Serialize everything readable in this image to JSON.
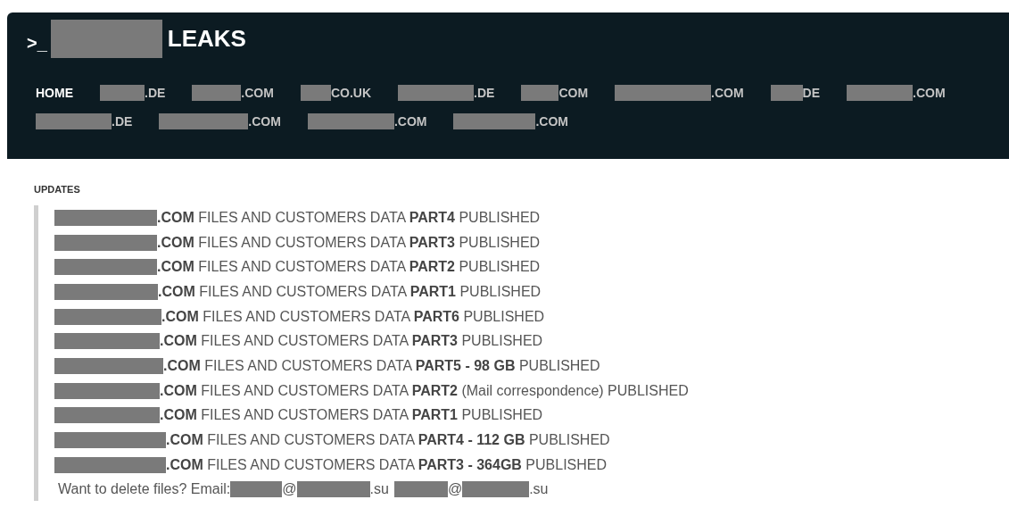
{
  "header": {
    "prompt": ">_",
    "title": "LEAKS"
  },
  "nav": [
    {
      "label": "HOME",
      "selected": true,
      "redacted": false
    },
    {
      "label": ".DE",
      "selected": false,
      "redacted": true
    },
    {
      "label": ".COM",
      "selected": false,
      "redacted": true
    },
    {
      "label": "CO.UK",
      "selected": false,
      "redacted": true
    },
    {
      "label": ".DE",
      "selected": false,
      "redacted": true
    },
    {
      "label": "COM",
      "selected": false,
      "redacted": true
    },
    {
      "label": ".COM",
      "selected": false,
      "redacted": true
    },
    {
      "label": "DE",
      "selected": false,
      "redacted": true
    },
    {
      "label": ".COM",
      "selected": false,
      "redacted": true
    },
    {
      "label": ".DE",
      "selected": false,
      "redacted": true
    },
    {
      "label": ".COM",
      "selected": false,
      "redacted": true
    },
    {
      "label": ".COM",
      "selected": false,
      "redacted": true
    },
    {
      "label": ".COM",
      "selected": false,
      "redacted": true
    }
  ],
  "updates": {
    "heading": "UPDATES",
    "items": [
      {
        "text": "**.COM** FILES AND CUSTOMERS DATA **PART4** PUBLISHED"
      },
      {
        "text": "**.COM** FILES AND CUSTOMERS DATA **PART3** PUBLISHED"
      },
      {
        "text": "**.COM** FILES AND CUSTOMERS DATA **PART2** PUBLISHED"
      },
      {
        "text": "**.COM** FILES AND CUSTOMERS DATA **PART1** PUBLISHED"
      },
      {
        "text": "**.COM** FILES AND CUSTOMERS DATA **PART6** PUBLISHED"
      },
      {
        "text": "**.COM** FILES AND CUSTOMERS DATA **PART3** PUBLISHED"
      },
      {
        "text": "**.COM** FILES AND CUSTOMERS DATA **PART5 - 98 GB** PUBLISHED"
      },
      {
        "text": "**.COM** FILES AND CUSTOMERS DATA **PART2** (Mail correspondence) PUBLISHED"
      },
      {
        "text": "**.COM** FILES AND CUSTOMERS DATA **PART1** PUBLISHED"
      },
      {
        "text": "**.COM** FILES AND CUSTOMERS DATA **PART4 - 112 GB** PUBLISHED"
      },
      {
        "text": "**.COM** FILES AND CUSTOMERS DATA **PART3 - 364GB** PUBLISHED"
      }
    ],
    "contact": {
      "label": "Want to delete files? Email:",
      "addresses": [
        {
          "at": "@",
          "domain_end": ".su"
        },
        {
          "at": "@",
          "domain_end": ".su"
        }
      ]
    }
  }
}
